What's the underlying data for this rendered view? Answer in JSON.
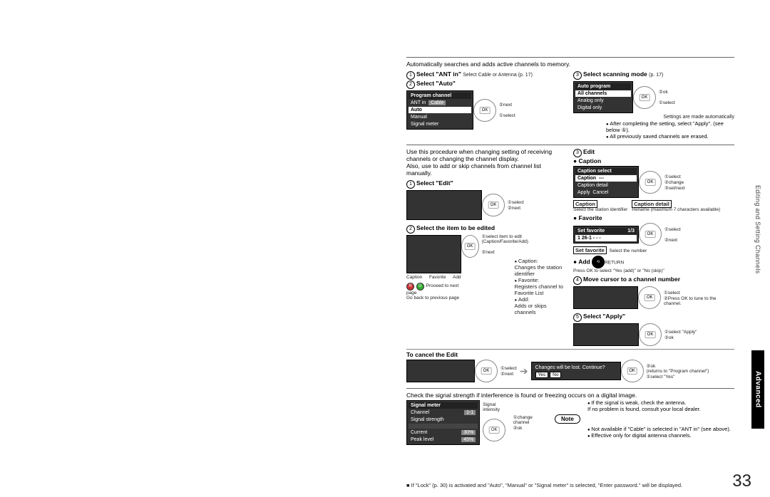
{
  "pagenum": "33",
  "side_text": "Editing and Setting Channels",
  "adv_tab": "Advanced",
  "sec1": {
    "intro": "Automatically searches and adds active channels to memory.",
    "s1a": "Select \"ANT in\"",
    "s1a_hint": "Select Cable or Antenna (p. 17)",
    "s2a": "Select \"Auto\"",
    "pc_title": "Program channel",
    "pc_r1a": "ANT in",
    "pc_r1b": "Cable",
    "pc_r2": "Auto",
    "pc_r3": "Manual",
    "pc_r4": "Signal meter",
    "okr1": "next",
    "okr2": "select",
    "s3a": "Select scanning mode",
    "s3a_p": "(p. 17)",
    "ap_title": "Auto program",
    "ap_r1": "All channels",
    "ap_r2": "Analog only",
    "ap_r3": "Digital only",
    "ok2r1": "ok",
    "ok2r2": "select",
    "auto_note": "Settings are made automatically",
    "b1": "After completing the setting, select \"Apply\". (see below ⑤).",
    "b2": "All previously saved channels are erased."
  },
  "sec2": {
    "intro1": "Use this procedure when changing setting of receiving channels or changing the channel display.",
    "intro2": "Also, use to add or skip channels from channel list manually.",
    "s1": "Select \"Edit\"",
    "ok1r1": "select",
    "ok1r2": "next",
    "s2": "Select the item to be edited",
    "notes_sel": "select item to edit (Caption/Favorite/Add)",
    "notes_next": "next",
    "lbl_fav": "Favorite",
    "lbl_cap": "Caption",
    "lbl_add": "Add",
    "capnote": "Caption:",
    "capnote2": "Changes the station identifier",
    "favnote": "Favorite:",
    "favnote2": "Registers channel to Favorite List",
    "addnote": "Add:",
    "addnote2": "Adds or skips channels",
    "rg_next": "Proceed to next page",
    "rg_prev": "Go back to previous page",
    "right_edit": "Edit",
    "right_cap": "Caption",
    "cs_title": "Caption select",
    "cs_r1a": "Caption",
    "cs_r1b": "---",
    "cs_r2": "Caption detail",
    "cs_apply": "Apply",
    "cs_cancel": "Cancel",
    "cs_ok1": "select",
    "cs_ok2": "change",
    "cs_ok3": "set/next",
    "cap_box": "Caption",
    "cap_det_box": "Caption detail",
    "cap_text": "Select the station identifier",
    "cap_det_text": "Rename (maximum 7 characters available)",
    "fav": "Favorite",
    "sf_title": "Set favorite",
    "sf_num": "1/3",
    "sf_row": "1  26-1   - - -",
    "sf_ok1": "select",
    "sf_ok2": "next",
    "sf_box": "Set favorite",
    "sf_text": "Select the number",
    "add_h": "Add",
    "add_text": "Press OK to select \"Yes (add)\" or \"No (skip)\"",
    "return": "RETURN",
    "s4": "Move cursor to a channel number",
    "s4_ok1": "select",
    "s4_ok2": "Press OK to tune to the channel.",
    "s5": "Select \"Apply\"",
    "s5_ok1": "select \"Apply\"",
    "s5_ok2": "ok",
    "cancel_h": "To cancel the Edit",
    "cancel_ok1": "select",
    "cancel_ok2": "next",
    "dlg": "Changes will be lost. Continue?",
    "yes": "Yes",
    "no": "No",
    "dlg_ok1": "ok",
    "dlg_ok2": "(returns to \"Program channel\")",
    "dlg_ok3": "select \"Yes\""
  },
  "sec3": {
    "intro": "Check the signal strength if interference is found or freezing occurs on a digital image.",
    "sm_title": "Signal  meter",
    "sm_ch": "Channel",
    "sm_chv": "1-1",
    "sm_ss": "Signal  strength",
    "sm_cur": "Current",
    "sm_curv": "30%",
    "sm_pk": "Peak level",
    "sm_pkv": "45%",
    "sm_si": "Signal intensity",
    "sm_ok1": "change channel",
    "sm_ok2": "ok",
    "b1": "If the signal is weak, check the antenna.",
    "b1b": "If no problem is found, consult your local dealer.",
    "note_lbl": "Note",
    "n1": "Not available if \"Cable\" is selected in \"ANT in\" (see above).",
    "n2": "Effective only for digital antenna channels."
  },
  "foot": "If \"Lock\" (p. 30) is activated and \"Auto\", \"Manual\" or \"Signal meter\" is selected, \"Enter password.\" will be displayed."
}
